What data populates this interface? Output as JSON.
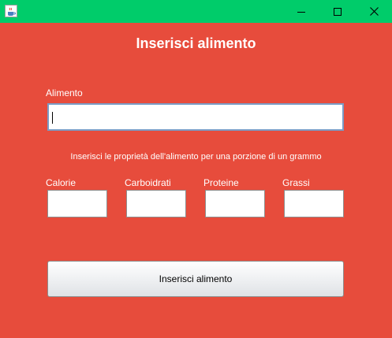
{
  "window": {
    "icon": "java-cup-icon",
    "controls": [
      "minimize-icon",
      "maximize-icon",
      "close-icon"
    ]
  },
  "form": {
    "title": "Inserisci alimento",
    "food_label": "Alimento",
    "food_value": "",
    "instruction": "Inserisci le proprietà dell'alimento per una porzione di un grammo",
    "fields": [
      {
        "label": "Calorie",
        "value": ""
      },
      {
        "label": "Carboidrati",
        "value": ""
      },
      {
        "label": "Proteine",
        "value": ""
      },
      {
        "label": "Grassi",
        "value": ""
      }
    ],
    "submit_label": "Inserisci alimento"
  },
  "colors": {
    "titlebar": "#00cc6a",
    "background": "#e74c3c",
    "text": "#ffffff",
    "focus_border": "#7a9cc6"
  }
}
